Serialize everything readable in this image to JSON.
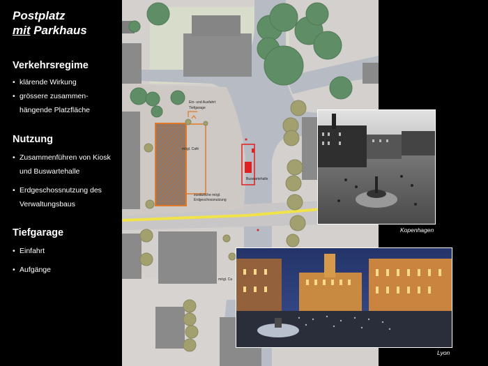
{
  "sidebar": {
    "title_line1": "Postplatz",
    "title_line2": "mit",
    "title_line2_rest": " Parkhaus",
    "sections": [
      {
        "heading": "Verkehrsregime",
        "bullets": [
          {
            "lines": [
              "klärende Wirkung"
            ]
          },
          {
            "lines": [
              "grössere zusammen-",
              "hängende Platzfläche"
            ]
          }
        ]
      },
      {
        "heading": "Nutzung",
        "bullets": [
          {
            "lines": [
              "Zusammenführen von Kiosk",
              "und Buswartehalle"
            ]
          },
          {
            "lines": [
              "Erdgeschossnutzung des",
              "Verwaltungsbaus"
            ]
          }
        ]
      },
      {
        "heading": "Tiefgarage",
        "bullets": [
          {
            "lines": [
              "Einfahrt"
            ]
          },
          {
            "lines": [
              "Aufgänge"
            ]
          }
        ]
      }
    ]
  },
  "map": {
    "labels": {
      "garage_entry_1": "Ein- und Ausfahrt",
      "garage_entry_2": "Tiefgarage",
      "cafe": "mögl. Café",
      "extra_1": "zusätzliche mögl.",
      "extra_2": "Erdgeschossnutzung",
      "bus": "Buswartehalle",
      "cafe2": "mögl. Ca"
    },
    "colors": {
      "street": "#b7bbc4",
      "building": "#8a8a8a",
      "plaza": "#cfcbc8",
      "tree": "#5f8d65",
      "highlight_orange": "#e07a2a",
      "highlight_red": "#e02020",
      "line_yellow": "#f0e34a"
    }
  },
  "photos": {
    "kopenhagen": {
      "caption": "Kopenhagen"
    },
    "lyon": {
      "caption": "Lyon"
    }
  }
}
